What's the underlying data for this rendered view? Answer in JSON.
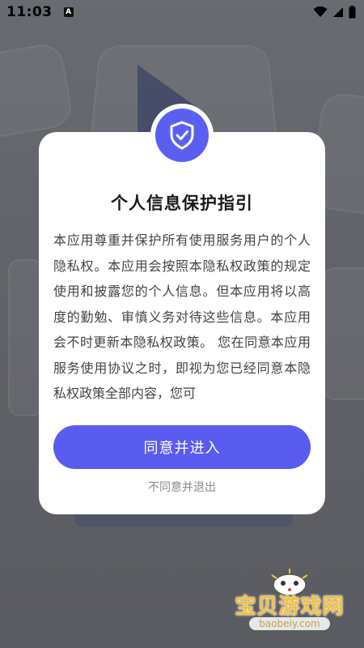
{
  "status_bar": {
    "time": "11:03",
    "notification_badge": "A"
  },
  "dialog": {
    "title": "个人信息保护指引",
    "body": "本应用尊重并保护所有使用服务用户的个人隐私权。本应用会按照本隐私权政策的规定使用和披露您的个人信息。但本应用将以高度的勤勉、审慎义务对待这些信息。本应用会不时更新本隐私权政策。 您在同意本应用服务使用协议之时，即视为您已经同意本隐私权政策全部内容，您可",
    "agree_label": "同意并进入",
    "disagree_label": "不同意并退出",
    "icon": "shield-check-icon"
  },
  "watermark": {
    "title": "宝贝游戏网",
    "url": "baobeiy.com"
  },
  "colors": {
    "accent": "#5a5cf0",
    "watermark": "#f4c23a"
  }
}
